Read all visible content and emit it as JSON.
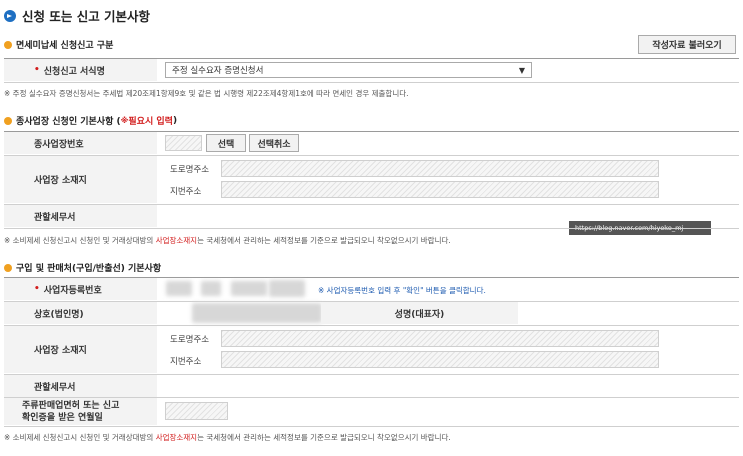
{
  "page": {
    "title": "신청 또는 신고 기본사항"
  },
  "section1": {
    "heading": "면세미납세 신청신고 구분",
    "load_button": "작성자료 불러오기",
    "form_label": "신청신고 서식명",
    "form_value": "주정 실수요자 증명신청서",
    "note": "※ 주정 실수요자 증명신청서는 주세법 제20조제1항제9호 및 같은 법 시행령 제22조제4항제1호에 따라 면세인 경우 제출합니다."
  },
  "section2": {
    "heading_prefix": "종사업장 신청인 기본사항 (",
    "heading_required": "필요시 입력",
    "heading_suffix": ")",
    "row_business_no": "종사업장번호",
    "select_button": "선택",
    "deselect_button": "선택취소",
    "row_address": "사업장 소재지",
    "road_address_label": "도로명주소",
    "lot_address_label": "지번주소",
    "row_tax_office": "관할세무서",
    "tooltip": "https://blog.naver.com/hiyoko_mj",
    "note_prefix": "※ 소비제세 신청신고시 신청인 및 거래상대방의 ",
    "note_highlight": "사업장소재지",
    "note_suffix": "는 국세청에서 관리하는 세적정보를 기준으로 발급되오니 착오없으시기 바랍니다."
  },
  "section3": {
    "heading": "구입 및 판매처(구입/반출선) 기본사항",
    "row_reg_no": "사업자등록번호",
    "reg_hint": "※ 사업자등록번호 입력 후 \"확인\" 버튼을 클릭합니다.",
    "row_company": "상호(법인명)",
    "row_rep": "성명(대표자)",
    "row_address": "사업장 소재지",
    "road_address_label": "도로명주소",
    "lot_address_label": "지번주소",
    "row_tax_office": "관할세무서",
    "row_license_line1": "주류판매업면허 또는 신고",
    "row_license_line2": "확인증을 받은 연월일",
    "note_prefix": "※ 소비제세 신청신고시 신청인 및 거래상대방의 ",
    "note_highlight": "사업장소재지",
    "note_suffix": "는 국세청에서 관리하는 세적정보를 기준으로 발급되오니 착오없으시기 바랍니다."
  },
  "colors": {
    "accent": "#1e6fc2",
    "bullet": "#f0a020",
    "required": "#d21e1e"
  }
}
